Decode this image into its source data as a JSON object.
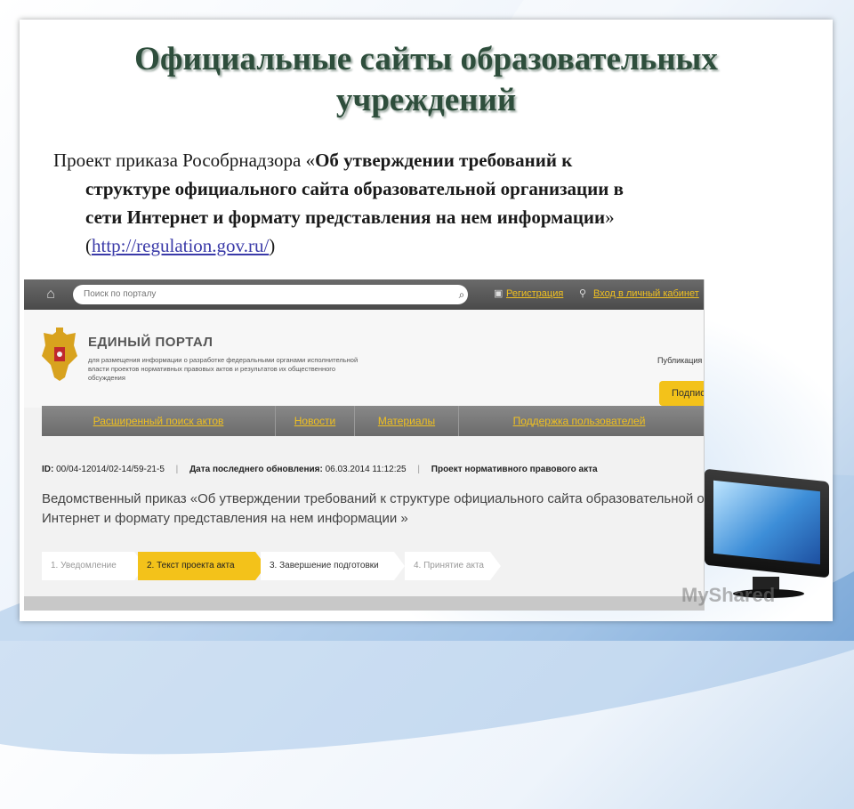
{
  "slide": {
    "title_line1": "Официальные сайты образовательных",
    "title_line2": "учреждений",
    "body_prefix": "Проект приказа Рособрнадзора «",
    "body_bold_1": "Об утверждении требований к",
    "body_bold_2": "структуре официального сайта образовательной организации в",
    "body_bold_3": "сети Интернет и формату представления на нем информации",
    "body_close_quote": "»",
    "link_open": "(",
    "link_text": "http://regulation.gov.ru/",
    "link_close": ")"
  },
  "portal": {
    "search_placeholder": "Поиск по порталу",
    "register_label": "Регистрация",
    "login_label": "Вход в личный кабинет",
    "name": "ЕДИНЫЙ ПОРТАЛ",
    "description": "для размещения информации о разработке федеральными органами исполнительной власти проектов нормативных правовых актов и результатов их общественного обсуждения",
    "publication_label": "Публикация",
    "subscribe_label": "Подпис",
    "nav": [
      {
        "label": "Расширенный поиск актов"
      },
      {
        "label": "Новости"
      },
      {
        "label": "Материалы"
      },
      {
        "label": "Поддержка пользователей"
      }
    ],
    "meta": {
      "id_label": "ID:",
      "id_value": "00/04-12014/02-14/59-21-5",
      "updated_label": "Дата последнего обновления:",
      "updated_value": "06.03.2014 11:12:25",
      "type": "Проект нормативного правового акта"
    },
    "doc_title_line1": "Ведомственный приказ «Об утверждении требований к структуре официального сайта образовательной орга",
    "doc_title_line2": "Интернет и формату представления на нем информации »",
    "steps": [
      {
        "label": "1. Уведомление"
      },
      {
        "label": "2. Текст проекта акта"
      },
      {
        "label": "3. Завершение подготовки"
      },
      {
        "label": "4. Принятие акта"
      }
    ]
  },
  "watermark": "MyShared",
  "colors": {
    "title": "#2e4e3c",
    "accent_yellow": "#f3c21a",
    "link": "#3a3aa8"
  }
}
